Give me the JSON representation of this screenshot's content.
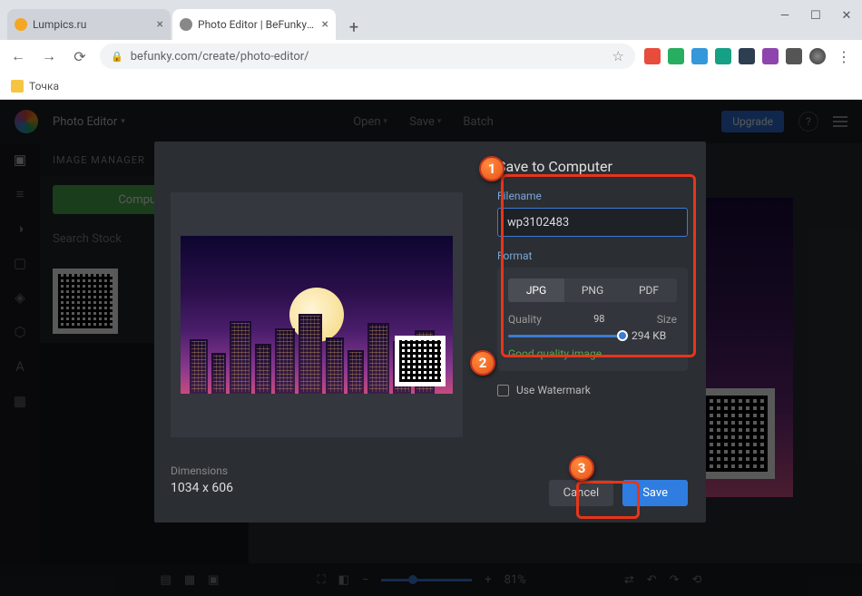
{
  "browser": {
    "tabs": [
      {
        "label": "Lumpics.ru"
      },
      {
        "label": "Photo Editor | BeFunky: Free Onl..."
      }
    ],
    "newtab": "+",
    "url": "befunky.com/create/photo-editor/",
    "bookmark": "Точка"
  },
  "app": {
    "title": "Photo Editor",
    "menu": {
      "open": "Open",
      "save": "Save",
      "batch": "Batch"
    },
    "upgrade": "Upgrade"
  },
  "panel": {
    "title": "IMAGE MANAGER",
    "computer_btn": "Computer",
    "search": "Search Stock"
  },
  "bottombar": {
    "zoom": "81%"
  },
  "modal": {
    "title": "Save to Computer",
    "filename_label": "Filename",
    "filename_value": "wp3102483",
    "format_label": "Format",
    "formats": {
      "jpg": "JPG",
      "png": "PNG",
      "pdf": "PDF"
    },
    "quality_label": "Quality",
    "quality_value": "98",
    "size_label": "Size",
    "size_value": "294 KB",
    "quality_note": "Good quality image",
    "watermark": "Use Watermark",
    "dimensions_label": "Dimensions",
    "dimensions_value": "1034 x 606",
    "cancel": "Cancel",
    "save": "Save"
  },
  "callouts": {
    "c1": "1",
    "c2": "2",
    "c3": "3"
  }
}
